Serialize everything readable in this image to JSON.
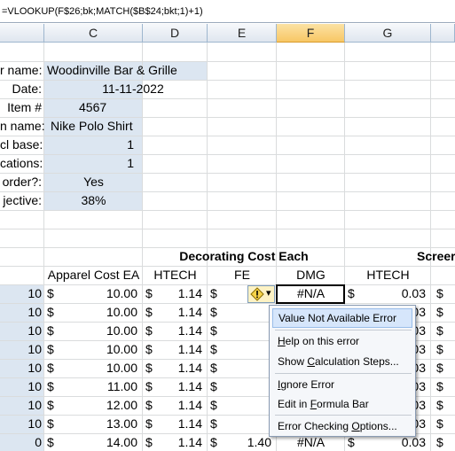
{
  "formula_bar": {
    "text": "=VLOOKUP(F$26;bk;MATCH($B$24;bkt;1)+1)"
  },
  "columns": [
    {
      "label": ""
    },
    {
      "label": "C"
    },
    {
      "label": "D"
    },
    {
      "label": "E"
    },
    {
      "label": "F"
    },
    {
      "label": "G"
    },
    {
      "label": ""
    }
  ],
  "form": {
    "labels": [
      "r name:",
      "Date:",
      "Item #",
      "n name:",
      "cl base:",
      "cations:",
      "order?:",
      "jective:"
    ],
    "values": [
      "Woodinville Bar & Grille",
      "11-11-2022",
      "4567",
      "Nike Polo Shirt",
      "1",
      "1",
      "Yes",
      "38%"
    ]
  },
  "section_headers": {
    "decorating": "Decorating Cost Each",
    "screen": "Screer"
  },
  "sub_headers": {
    "apparel": "Apparel Cost EA",
    "htech_d": "HTECH",
    "fe": "FE",
    "dmg": "DMG",
    "htech_g": "HTECH"
  },
  "rows": [
    {
      "qty": "10",
      "apparel": "10.00",
      "htech": "1.14",
      "fe": "",
      "dmg": "#N/A",
      "g": "0.03"
    },
    {
      "qty": "10",
      "apparel": "10.00",
      "htech": "1.14",
      "fe": "",
      "dmg": "",
      "g": "03"
    },
    {
      "qty": "10",
      "apparel": "10.00",
      "htech": "1.14",
      "fe": "",
      "dmg": "",
      "g": "03"
    },
    {
      "qty": "10",
      "apparel": "10.00",
      "htech": "1.14",
      "fe": "",
      "dmg": "",
      "g": "03"
    },
    {
      "qty": "10",
      "apparel": "10.00",
      "htech": "1.14",
      "fe": "",
      "dmg": "",
      "g": "03"
    },
    {
      "qty": "10",
      "apparel": "11.00",
      "htech": "1.14",
      "fe": "",
      "dmg": "",
      "g": "03"
    },
    {
      "qty": "10",
      "apparel": "12.00",
      "htech": "1.14",
      "fe": "",
      "dmg": "",
      "g": "03"
    },
    {
      "qty": "10",
      "apparel": "13.00",
      "htech": "1.14",
      "fe": "",
      "dmg": "",
      "g": "03"
    },
    {
      "qty": "0",
      "apparel": "14.00",
      "htech": "1.14",
      "fe": "1.40",
      "dmg": "#N/A",
      "g": "0.03"
    }
  ],
  "currency_symbol": "$",
  "smart_tag": {
    "icon": "warning-diamond-icon",
    "dropdown": "▾"
  },
  "error_menu": {
    "title": "Value Not Available Error",
    "items": [
      {
        "pre": "",
        "key": "H",
        "post": "elp on this error"
      },
      {
        "pre": "Show ",
        "key": "C",
        "post": "alculation Steps..."
      },
      {
        "pre": "",
        "key": "I",
        "post": "gnore Error"
      },
      {
        "pre": "Edit in ",
        "key": "F",
        "post": "ormula Bar"
      },
      {
        "pre": "Error Checking ",
        "key": "O",
        "post": "ptions..."
      }
    ]
  },
  "colors": {
    "input_fill": "#dce6f1",
    "selected_header": "#f8c765",
    "menu_highlight": "#d6e6fb"
  }
}
